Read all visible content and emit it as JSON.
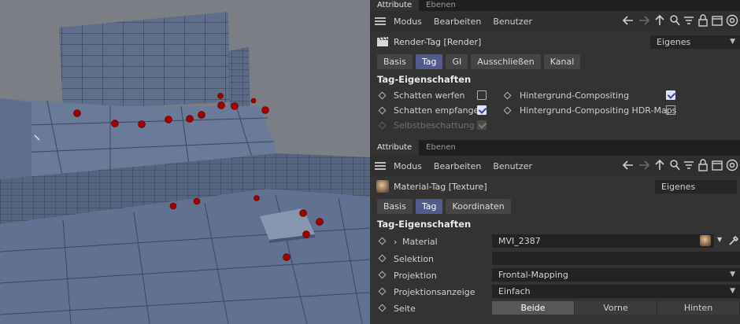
{
  "viewport": {
    "label": "3D viewport"
  },
  "attr1": {
    "tabs": [
      "Attribute",
      "Ebenen"
    ],
    "menu": [
      "Modus",
      "Bearbeiten",
      "Benutzer"
    ],
    "object_title": "Render-Tag [Render]",
    "mode_dropdown": "Eigenes",
    "subtabs": [
      "Basis",
      "Tag",
      "GI",
      "Ausschließen",
      "Kanal"
    ],
    "active_subtab": "Tag",
    "section_title": "Tag-Eigenschaften",
    "props": {
      "schatten_werfen": "Schatten werfen",
      "schatten_empfangen": "Schatten empfangen",
      "selbstbeschattung": "Selbstbeschattung",
      "hintergrund_compositing": "Hintergrund-Compositing",
      "hintergrund_hdr": "Hintergrund-Compositing HDR-Maps"
    }
  },
  "attr2": {
    "tabs": [
      "Attribute",
      "Ebenen"
    ],
    "menu": [
      "Modus",
      "Bearbeiten",
      "Benutzer"
    ],
    "object_title": "Material-Tag [Texture]",
    "mode_dropdown": "Eigenes",
    "subtabs": [
      "Basis",
      "Tag",
      "Koordinaten"
    ],
    "active_subtab": "Tag",
    "section_title": "Tag-Eigenschaften",
    "props": {
      "material_label": "Material",
      "material_value": "MVI_2387",
      "selektion_label": "Selektion",
      "selektion_value": "",
      "projektion_label": "Projektion",
      "projektion_value": "Frontal-Mapping",
      "projektionsanzeige_label": "Projektionsanzeige",
      "projektionsanzeige_value": "Einfach",
      "seite_label": "Seite",
      "seite_options": [
        "Beide",
        "Vorne",
        "Hinten"
      ],
      "seite_selected": "Beide"
    }
  },
  "colors": {
    "accent": "#535a8e",
    "viewport_bg": "#777a80",
    "mesh_fill": "#5d6e8a",
    "marker": "#a30000"
  }
}
